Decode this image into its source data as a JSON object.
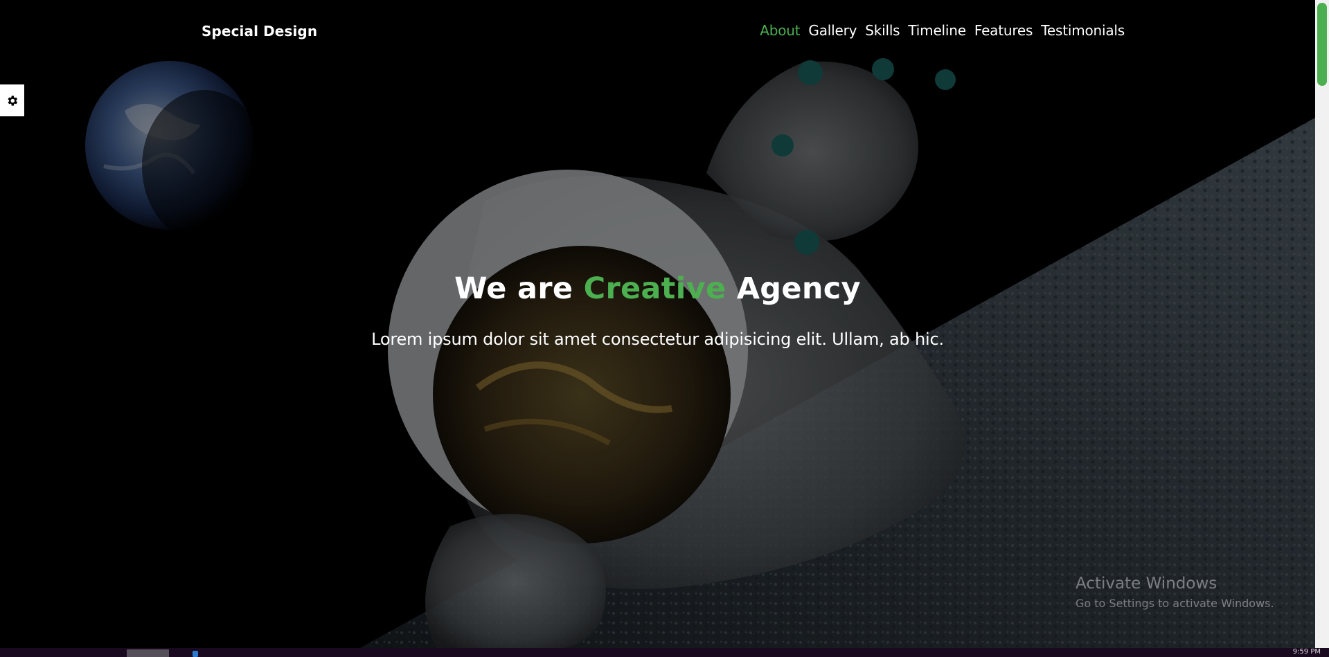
{
  "header": {
    "logo": "Special Design",
    "nav": [
      {
        "label": "About",
        "active": true
      },
      {
        "label": "Gallery",
        "active": false
      },
      {
        "label": "Skills",
        "active": false
      },
      {
        "label": "Timeline",
        "active": false
      },
      {
        "label": "Features",
        "active": false
      },
      {
        "label": "Testimonials",
        "active": false
      }
    ]
  },
  "settings": {
    "icon": "gear-icon"
  },
  "intro": {
    "title_before": "We are ",
    "title_accent": "Creative",
    "title_after": " Agency",
    "subtitle": "Lorem ipsum dolor sit amet consectetur adipisicing elit. Ullam, ab hic."
  },
  "watermark": {
    "line1": "Activate Windows",
    "line2": "Go to Settings to activate Windows."
  },
  "taskbar": {
    "clock": "9:59 PM"
  },
  "colors": {
    "accent": "#4caf50",
    "background": "#000000",
    "text": "#ffffff"
  }
}
